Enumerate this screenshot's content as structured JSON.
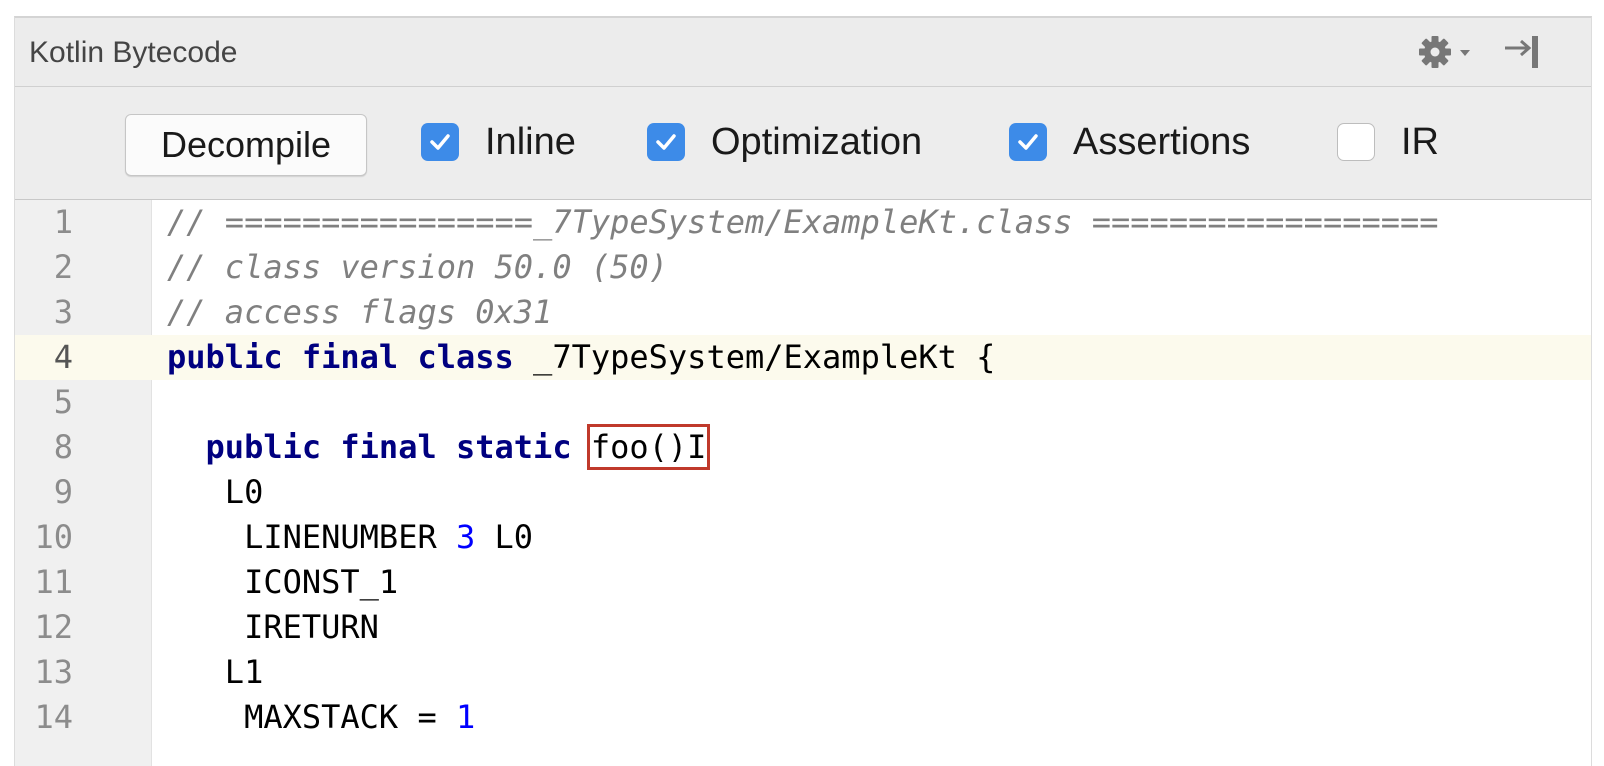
{
  "panel": {
    "title": "Kotlin Bytecode",
    "header_icons": [
      "gear-icon",
      "chevron-down-icon",
      "hide-panel-icon"
    ]
  },
  "toolbar": {
    "decompile_label": "Decompile",
    "options": [
      {
        "label": "Inline",
        "checked": true
      },
      {
        "label": "Optimization",
        "checked": true
      },
      {
        "label": "Assertions",
        "checked": true
      },
      {
        "label": "IR",
        "checked": false
      }
    ]
  },
  "editor": {
    "current_line": "4",
    "lines": [
      {
        "n": "1",
        "tokens": [
          {
            "t": "// ================_7TypeSystem/ExampleKt.class ==================",
            "c": "cm"
          }
        ]
      },
      {
        "n": "2",
        "tokens": [
          {
            "t": "// class version 50.0 (50)",
            "c": "cm"
          }
        ]
      },
      {
        "n": "3",
        "tokens": [
          {
            "t": "// access flags 0x31",
            "c": "cm"
          }
        ]
      },
      {
        "n": "4",
        "tokens": [
          {
            "t": "public",
            "c": "kw"
          },
          {
            "t": " "
          },
          {
            "t": "final",
            "c": "kw"
          },
          {
            "t": " "
          },
          {
            "t": "class",
            "c": "kw"
          },
          {
            "t": " _7TypeSystem/ExampleKt {"
          }
        ]
      },
      {
        "n": "5",
        "tokens": []
      },
      {
        "n": "8",
        "tokens": [
          {
            "t": "  "
          },
          {
            "t": "public",
            "c": "kw"
          },
          {
            "t": " "
          },
          {
            "t": "final",
            "c": "kw"
          },
          {
            "t": " "
          },
          {
            "t": "static",
            "c": "kw"
          },
          {
            "t": " "
          },
          {
            "t": "foo()I",
            "c": "hl"
          }
        ]
      },
      {
        "n": "9",
        "tokens": [
          {
            "t": "   L0"
          }
        ]
      },
      {
        "n": "10",
        "tokens": [
          {
            "t": "    LINENUMBER "
          },
          {
            "t": "3",
            "c": "num"
          },
          {
            "t": " L0"
          }
        ]
      },
      {
        "n": "11",
        "tokens": [
          {
            "t": "    ICONST_1"
          }
        ]
      },
      {
        "n": "12",
        "tokens": [
          {
            "t": "    IRETURN"
          }
        ]
      },
      {
        "n": "13",
        "tokens": [
          {
            "t": "   L1"
          }
        ]
      },
      {
        "n": "14",
        "tokens": [
          {
            "t": "    MAXSTACK = "
          },
          {
            "t": "1",
            "c": "num"
          }
        ]
      }
    ]
  }
}
